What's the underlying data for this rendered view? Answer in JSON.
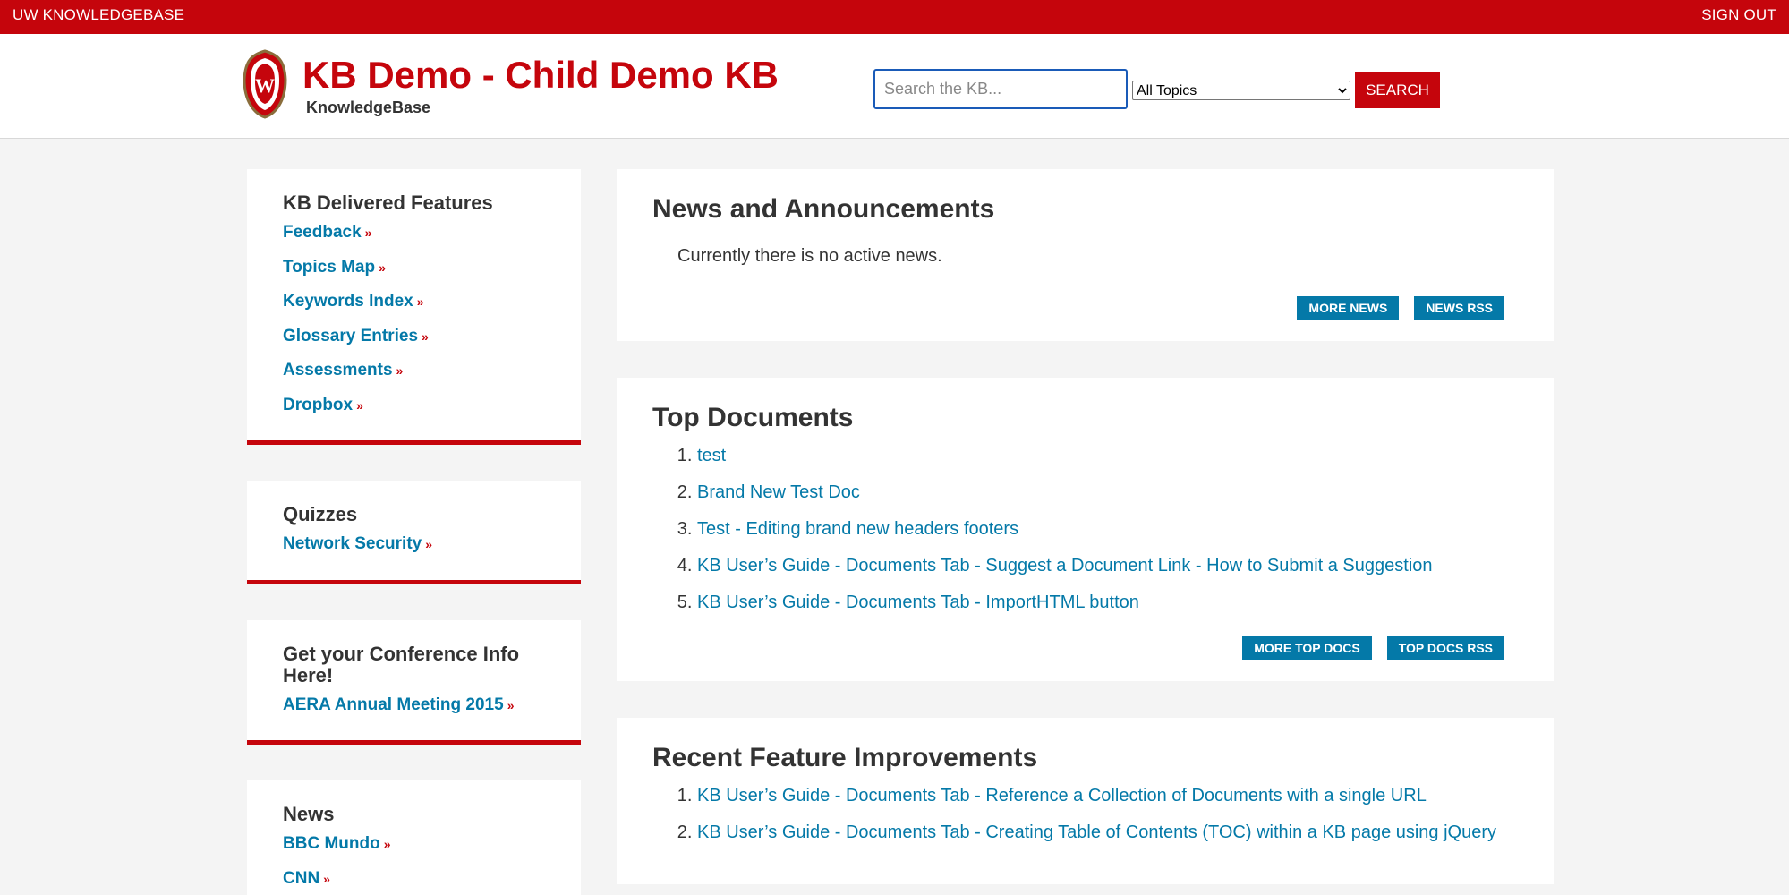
{
  "topbar": {
    "home_label": "UW KNOWLEDGEBASE",
    "signout_label": "SIGN OUT"
  },
  "header": {
    "title": "KB Demo - Child Demo KB",
    "subtitle": "KnowledgeBase",
    "crest_letter": "W"
  },
  "search": {
    "placeholder": "Search the KB...",
    "value": "",
    "topic_selected": "All Topics",
    "button_label": "SEARCH"
  },
  "sidebar": {
    "features": {
      "title": "KB Delivered Features",
      "items": [
        "Feedback",
        "Topics Map",
        "Keywords Index",
        "Glossary Entries",
        "Assessments",
        "Dropbox"
      ]
    },
    "quizzes": {
      "title": "Quizzes",
      "items": [
        "Network Security"
      ]
    },
    "conference": {
      "title": "Get your Conference Info Here!",
      "items": [
        "AERA Annual Meeting 2015"
      ]
    },
    "news": {
      "title": "News",
      "items": [
        "BBC Mundo",
        "CNN"
      ]
    },
    "arrow": "»"
  },
  "news_section": {
    "title": "News and Announcements",
    "empty_text": "Currently there is no active news.",
    "more_label": "MORE NEWS",
    "rss_label": "NEWS RSS"
  },
  "top_docs": {
    "title": "Top Documents",
    "items": [
      "test",
      "Brand New Test Doc",
      "Test - Editing brand new headers footers",
      "KB User’s Guide - Documents Tab - Suggest a Document Link - How to Submit a Suggestion",
      "KB User’s Guide - Documents Tab - ImportHTML button"
    ],
    "more_label": "MORE TOP DOCS",
    "rss_label": "TOP DOCS RSS"
  },
  "recent": {
    "title": "Recent Feature Improvements",
    "items": [
      "KB User’s Guide - Documents Tab - Reference a Collection of Documents with a single URL",
      "KB User’s Guide - Documents Tab - Creating Table of Contents (TOC) within a KB page using jQuery"
    ]
  },
  "colors": {
    "brand_red": "#c5050c",
    "link_blue": "#0479a8"
  }
}
